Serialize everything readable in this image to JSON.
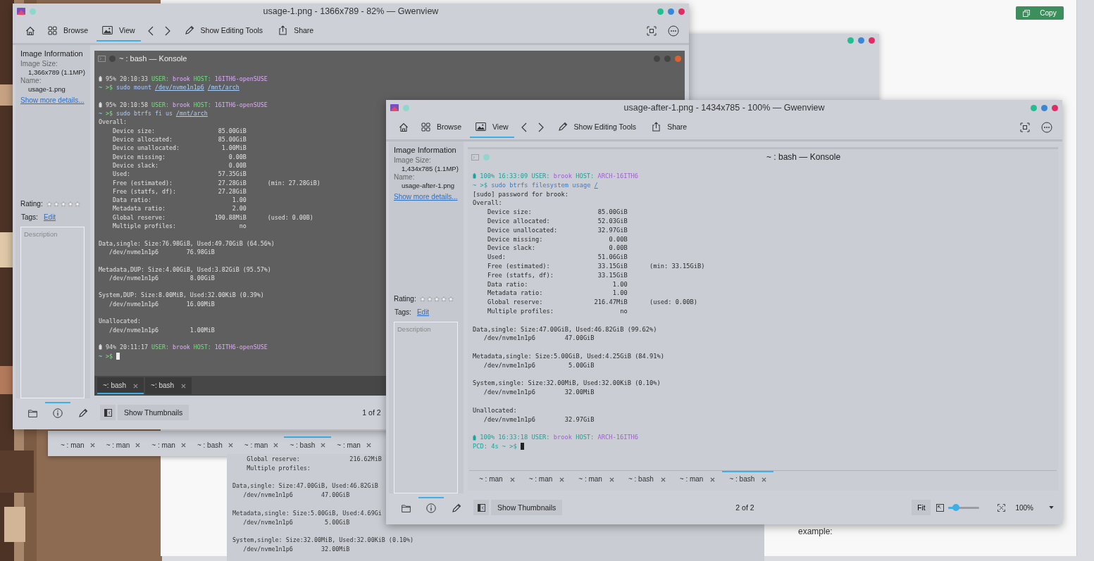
{
  "web_page": {
    "copy_button": "Copy",
    "lines": [
      "example:"
    ]
  },
  "back_konsole": {
    "tabs": [
      {
        "label": "~ : man",
        "selected": false
      },
      {
        "label": "~ : man",
        "selected": false
      },
      {
        "label": "~ : man",
        "selected": false
      },
      {
        "label": "~ : bash",
        "selected": false
      },
      {
        "label": "~ : man",
        "selected": false
      },
      {
        "label": "~ : bash",
        "selected": true
      },
      {
        "label": "~ : man",
        "selected": false
      }
    ],
    "lines": [
      {
        "kind": "stat",
        "label": "Global reserve:",
        "value": "216.62MiB"
      },
      {
        "kind": "stat",
        "label": "Multiple profiles:"
      },
      {
        "kind": "blank"
      },
      {
        "kind": "text",
        "text": "Data,single: Size:47.00GiB, Used:46.82GiB"
      },
      {
        "kind": "device",
        "path": "/dev/nvme1n1p6",
        "value": "47.00GiB"
      },
      {
        "kind": "blank"
      },
      {
        "kind": "text",
        "text": "Metadata,single: Size:5.00GiB, Used:4.69Gi"
      },
      {
        "kind": "device",
        "path": "/dev/nvme1n1p6",
        "value": "5.00GiB"
      },
      {
        "kind": "blank"
      },
      {
        "kind": "text",
        "text": "System,single: Size:32.00MiB, Used:32.00KiB (0.10%)"
      },
      {
        "kind": "device",
        "path": "/dev/nvme1n1p6",
        "value": "32.00MiB"
      }
    ]
  },
  "windows": [
    {
      "title": "usage-1.png - 1366x789 - 82% — Gwenview",
      "toolbar": {
        "tabs": [
          {
            "label": "Browse",
            "kind": "browse",
            "selected": false
          },
          {
            "label": "View",
            "kind": "view",
            "selected": true
          }
        ],
        "actions": [
          {
            "label": "Show Editing Tools",
            "kind": "edit"
          },
          {
            "label": "Share",
            "kind": "share"
          }
        ]
      },
      "sidebar": {
        "heading": "Image Information",
        "fields": [
          {
            "label": "Image Size:",
            "value": "1,366x789 (1.1MP)"
          },
          {
            "label": "Name:",
            "value": "usage-1.png"
          }
        ],
        "link": "Show more details...",
        "rating_label": "Rating:",
        "stars": 0,
        "tags_label": "Tags:",
        "tags_link": "Edit",
        "description": {
          "placeholder": "Description"
        }
      },
      "konsole": {
        "title": "~ : bash — Konsole",
        "lines": [
          {
            "kind": "prompt",
            "battery": "95%",
            "time": "20:10:33",
            "user_label": "USER:",
            "user": "brook",
            "host_label": "HOST:",
            "host": "16ITH6-openSUSE"
          },
          {
            "kind": "command",
            "cwd": "~",
            "sign": ">$",
            "command": "sudo mount",
            "args": [
              "/dev/nvme1n1p6",
              "/mnt/arch"
            ]
          },
          {
            "kind": "blank"
          },
          {
            "kind": "prompt",
            "battery": "95%",
            "time": "20:10:58",
            "user_label": "USER:",
            "user": "brook",
            "host_label": "HOST:",
            "host": "16ITH6-openSUSE"
          },
          {
            "kind": "command",
            "cwd": "~",
            "sign": ">$",
            "command": "sudo btrfs fi us",
            "args": [
              "/mnt/arch"
            ]
          },
          {
            "kind": "text",
            "text": "Overall:"
          },
          {
            "kind": "stat",
            "label": "Device size:",
            "value": "85.00GiB"
          },
          {
            "kind": "stat",
            "label": "Device allocated:",
            "value": "85.00GiB"
          },
          {
            "kind": "stat",
            "label": "Device unallocated:",
            "value": "1.00MiB"
          },
          {
            "kind": "stat",
            "label": "Device missing:",
            "value": "0.00B"
          },
          {
            "kind": "stat",
            "label": "Device slack:",
            "value": "0.00B"
          },
          {
            "kind": "stat",
            "label": "Used:",
            "value": "57.35GiB"
          },
          {
            "kind": "stat",
            "label": "Free (estimated):",
            "value": "27.28GiB",
            "note": "(min: 27.28GiB)"
          },
          {
            "kind": "stat",
            "label": "Free (statfs, df):",
            "value": "27.28GiB"
          },
          {
            "kind": "stat",
            "label": "Data ratio:",
            "value": "1.00"
          },
          {
            "kind": "stat",
            "label": "Metadata ratio:",
            "value": "2.00"
          },
          {
            "kind": "stat",
            "label": "Global reserve:",
            "value": "190.88MiB",
            "note": "(used: 0.00B)"
          },
          {
            "kind": "stat",
            "label": "Multiple profiles:",
            "value": "no"
          },
          {
            "kind": "blank"
          },
          {
            "kind": "text",
            "text": "Data,single: Size:76.98GiB, Used:49.70GiB (64.56%)"
          },
          {
            "kind": "device",
            "path": "/dev/nvme1n1p6",
            "value": "76.98GiB"
          },
          {
            "kind": "blank"
          },
          {
            "kind": "text",
            "text": "Metadata,DUP: Size:4.00GiB, Used:3.82GiB (95.57%)"
          },
          {
            "kind": "device",
            "path": "/dev/nvme1n1p6",
            "value": "8.00GiB"
          },
          {
            "kind": "blank"
          },
          {
            "kind": "text",
            "text": "System,DUP: Size:8.00MiB, Used:32.00KiB (0.39%)"
          },
          {
            "kind": "device",
            "path": "/dev/nvme1n1p6",
            "value": "16.00MiB"
          },
          {
            "kind": "blank"
          },
          {
            "kind": "text",
            "text": "Unallocated:"
          },
          {
            "kind": "device",
            "path": "/dev/nvme1n1p6",
            "value": "1.00MiB"
          },
          {
            "kind": "blank"
          },
          {
            "kind": "prompt",
            "battery": "94%",
            "time": "20:11:17",
            "user_label": "USER:",
            "user": "brook",
            "host_label": "HOST:",
            "host": "16ITH6-openSUSE"
          },
          {
            "kind": "command",
            "cwd": "~",
            "sign": ">$",
            "cursor": true
          }
        ],
        "tabs": [
          {
            "label": "~: bash",
            "selected": true
          },
          {
            "label": "~: bash",
            "selected": false
          }
        ]
      },
      "footer": {
        "sidebar_tabs": [
          {
            "kind": "folder",
            "selected": false
          },
          {
            "kind": "info",
            "selected": true
          },
          {
            "kind": "edit",
            "selected": false
          }
        ],
        "thumbnails_button": "Show Thumbnails",
        "counter": "1 of 2"
      }
    },
    {
      "title": "usage-after-1.png - 1434x785 - 100% — Gwenview",
      "toolbar": {
        "tabs": [
          {
            "label": "Browse",
            "kind": "browse",
            "selected": false
          },
          {
            "label": "View",
            "kind": "view",
            "selected": true
          }
        ],
        "actions": [
          {
            "label": "Show Editing Tools",
            "kind": "edit"
          },
          {
            "label": "Share",
            "kind": "share"
          }
        ]
      },
      "sidebar": {
        "heading": "Image Information",
        "fields": [
          {
            "label": "Image Size:",
            "value": "1,434x785 (1.1MP)"
          },
          {
            "label": "Name:",
            "value": "usage-after-1.png"
          }
        ],
        "link": "Show more details...",
        "rating_label": "Rating:",
        "stars": 0,
        "tags_label": "Tags:",
        "tags_link": "Edit",
        "description": {
          "placeholder": "Description"
        }
      },
      "konsole": {
        "title": "~ : bash — Konsole",
        "lines": [
          {
            "kind": "prompt",
            "battery": "100%",
            "time": "16:33:09",
            "user_label": "USER:",
            "user": "brook",
            "host_label": "HOST:",
            "host": "ARCH-16ITH6"
          },
          {
            "kind": "command",
            "cwd": "~",
            "sign": ">$",
            "command": "sudo btrfs filesystem usage",
            "args": [
              "/"
            ]
          },
          {
            "kind": "text",
            "text": "[sudo] password for brook:"
          },
          {
            "kind": "text",
            "text": "Overall:"
          },
          {
            "kind": "stat",
            "label": "Device size:",
            "value": "85.00GiB"
          },
          {
            "kind": "stat",
            "label": "Device allocated:",
            "value": "52.03GiB"
          },
          {
            "kind": "stat",
            "label": "Device unallocated:",
            "value": "32.97GiB"
          },
          {
            "kind": "stat",
            "label": "Device missing:",
            "value": "0.00B"
          },
          {
            "kind": "stat",
            "label": "Device slack:",
            "value": "0.00B"
          },
          {
            "kind": "stat",
            "label": "Used:",
            "value": "51.06GiB"
          },
          {
            "kind": "stat",
            "label": "Free (estimated):",
            "value": "33.15GiB",
            "note": "(min: 33.15GiB)"
          },
          {
            "kind": "stat",
            "label": "Free (statfs, df):",
            "value": "33.15GiB"
          },
          {
            "kind": "stat",
            "label": "Data ratio:",
            "value": "1.00"
          },
          {
            "kind": "stat",
            "label": "Metadata ratio:",
            "value": "1.00"
          },
          {
            "kind": "stat",
            "label": "Global reserve:",
            "value": "216.47MiB",
            "note": "(used: 0.00B)"
          },
          {
            "kind": "stat",
            "label": "Multiple profiles:",
            "value": "no"
          },
          {
            "kind": "blank"
          },
          {
            "kind": "text",
            "text": "Data,single: Size:47.00GiB, Used:46.82GiB (99.62%)"
          },
          {
            "kind": "device",
            "path": "/dev/nvme1n1p6",
            "value": "47.00GiB"
          },
          {
            "kind": "blank"
          },
          {
            "kind": "text",
            "text": "Metadata,single: Size:5.00GiB, Used:4.25GiB (84.91%)"
          },
          {
            "kind": "device",
            "path": "/dev/nvme1n1p6",
            "value": "5.00GiB"
          },
          {
            "kind": "blank"
          },
          {
            "kind": "text",
            "text": "System,single: Size:32.00MiB, Used:32.00KiB (0.10%)"
          },
          {
            "kind": "device",
            "path": "/dev/nvme1n1p6",
            "value": "32.00MiB"
          },
          {
            "kind": "blank"
          },
          {
            "kind": "text",
            "text": "Unallocated:"
          },
          {
            "kind": "device",
            "path": "/dev/nvme1n1p6",
            "value": "32.97GiB"
          },
          {
            "kind": "blank"
          },
          {
            "kind": "prompt",
            "battery": "100%",
            "time": "16:33:18",
            "user_label": "USER:",
            "user": "brook",
            "host_label": "HOST:",
            "host": "ARCH-16ITH6"
          },
          {
            "kind": "command",
            "timer": "PCD: 4s",
            "cwd": "~",
            "sign": ">$",
            "cursor": true
          }
        ],
        "tabs": [
          {
            "label": "~ : man",
            "selected": false
          },
          {
            "label": "~ : man",
            "selected": false
          },
          {
            "label": "~ : man",
            "selected": false
          },
          {
            "label": "~ : bash",
            "selected": false
          },
          {
            "label": "~ : man",
            "selected": false
          },
          {
            "label": "~ : bash",
            "selected": true
          }
        ]
      },
      "footer": {
        "sidebar_tabs": [
          {
            "kind": "folder",
            "selected": false
          },
          {
            "kind": "info",
            "selected": true
          },
          {
            "kind": "edit",
            "selected": false
          }
        ],
        "thumbnails_button": "Show Thumbnails",
        "counter": "2 of 2",
        "zoom": {
          "fit": "Fit",
          "level": 0.25,
          "value": "100%"
        }
      }
    }
  ]
}
